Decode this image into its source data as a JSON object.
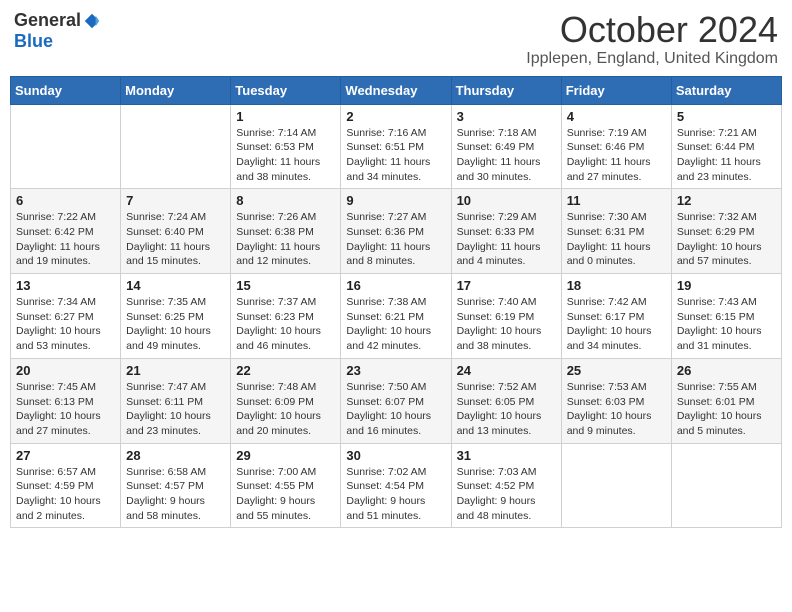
{
  "header": {
    "logo_general": "General",
    "logo_blue": "Blue",
    "month_title": "October 2024",
    "location": "Ipplepen, England, United Kingdom"
  },
  "days_of_week": [
    "Sunday",
    "Monday",
    "Tuesday",
    "Wednesday",
    "Thursday",
    "Friday",
    "Saturday"
  ],
  "weeks": [
    [
      {
        "day": "",
        "info": ""
      },
      {
        "day": "",
        "info": ""
      },
      {
        "day": "1",
        "info": "Sunrise: 7:14 AM\nSunset: 6:53 PM\nDaylight: 11 hours and 38 minutes."
      },
      {
        "day": "2",
        "info": "Sunrise: 7:16 AM\nSunset: 6:51 PM\nDaylight: 11 hours and 34 minutes."
      },
      {
        "day": "3",
        "info": "Sunrise: 7:18 AM\nSunset: 6:49 PM\nDaylight: 11 hours and 30 minutes."
      },
      {
        "day": "4",
        "info": "Sunrise: 7:19 AM\nSunset: 6:46 PM\nDaylight: 11 hours and 27 minutes."
      },
      {
        "day": "5",
        "info": "Sunrise: 7:21 AM\nSunset: 6:44 PM\nDaylight: 11 hours and 23 minutes."
      }
    ],
    [
      {
        "day": "6",
        "info": "Sunrise: 7:22 AM\nSunset: 6:42 PM\nDaylight: 11 hours and 19 minutes."
      },
      {
        "day": "7",
        "info": "Sunrise: 7:24 AM\nSunset: 6:40 PM\nDaylight: 11 hours and 15 minutes."
      },
      {
        "day": "8",
        "info": "Sunrise: 7:26 AM\nSunset: 6:38 PM\nDaylight: 11 hours and 12 minutes."
      },
      {
        "day": "9",
        "info": "Sunrise: 7:27 AM\nSunset: 6:36 PM\nDaylight: 11 hours and 8 minutes."
      },
      {
        "day": "10",
        "info": "Sunrise: 7:29 AM\nSunset: 6:33 PM\nDaylight: 11 hours and 4 minutes."
      },
      {
        "day": "11",
        "info": "Sunrise: 7:30 AM\nSunset: 6:31 PM\nDaylight: 11 hours and 0 minutes."
      },
      {
        "day": "12",
        "info": "Sunrise: 7:32 AM\nSunset: 6:29 PM\nDaylight: 10 hours and 57 minutes."
      }
    ],
    [
      {
        "day": "13",
        "info": "Sunrise: 7:34 AM\nSunset: 6:27 PM\nDaylight: 10 hours and 53 minutes."
      },
      {
        "day": "14",
        "info": "Sunrise: 7:35 AM\nSunset: 6:25 PM\nDaylight: 10 hours and 49 minutes."
      },
      {
        "day": "15",
        "info": "Sunrise: 7:37 AM\nSunset: 6:23 PM\nDaylight: 10 hours and 46 minutes."
      },
      {
        "day": "16",
        "info": "Sunrise: 7:38 AM\nSunset: 6:21 PM\nDaylight: 10 hours and 42 minutes."
      },
      {
        "day": "17",
        "info": "Sunrise: 7:40 AM\nSunset: 6:19 PM\nDaylight: 10 hours and 38 minutes."
      },
      {
        "day": "18",
        "info": "Sunrise: 7:42 AM\nSunset: 6:17 PM\nDaylight: 10 hours and 34 minutes."
      },
      {
        "day": "19",
        "info": "Sunrise: 7:43 AM\nSunset: 6:15 PM\nDaylight: 10 hours and 31 minutes."
      }
    ],
    [
      {
        "day": "20",
        "info": "Sunrise: 7:45 AM\nSunset: 6:13 PM\nDaylight: 10 hours and 27 minutes."
      },
      {
        "day": "21",
        "info": "Sunrise: 7:47 AM\nSunset: 6:11 PM\nDaylight: 10 hours and 23 minutes."
      },
      {
        "day": "22",
        "info": "Sunrise: 7:48 AM\nSunset: 6:09 PM\nDaylight: 10 hours and 20 minutes."
      },
      {
        "day": "23",
        "info": "Sunrise: 7:50 AM\nSunset: 6:07 PM\nDaylight: 10 hours and 16 minutes."
      },
      {
        "day": "24",
        "info": "Sunrise: 7:52 AM\nSunset: 6:05 PM\nDaylight: 10 hours and 13 minutes."
      },
      {
        "day": "25",
        "info": "Sunrise: 7:53 AM\nSunset: 6:03 PM\nDaylight: 10 hours and 9 minutes."
      },
      {
        "day": "26",
        "info": "Sunrise: 7:55 AM\nSunset: 6:01 PM\nDaylight: 10 hours and 5 minutes."
      }
    ],
    [
      {
        "day": "27",
        "info": "Sunrise: 6:57 AM\nSunset: 4:59 PM\nDaylight: 10 hours and 2 minutes."
      },
      {
        "day": "28",
        "info": "Sunrise: 6:58 AM\nSunset: 4:57 PM\nDaylight: 9 hours and 58 minutes."
      },
      {
        "day": "29",
        "info": "Sunrise: 7:00 AM\nSunset: 4:55 PM\nDaylight: 9 hours and 55 minutes."
      },
      {
        "day": "30",
        "info": "Sunrise: 7:02 AM\nSunset: 4:54 PM\nDaylight: 9 hours and 51 minutes."
      },
      {
        "day": "31",
        "info": "Sunrise: 7:03 AM\nSunset: 4:52 PM\nDaylight: 9 hours and 48 minutes."
      },
      {
        "day": "",
        "info": ""
      },
      {
        "day": "",
        "info": ""
      }
    ]
  ]
}
